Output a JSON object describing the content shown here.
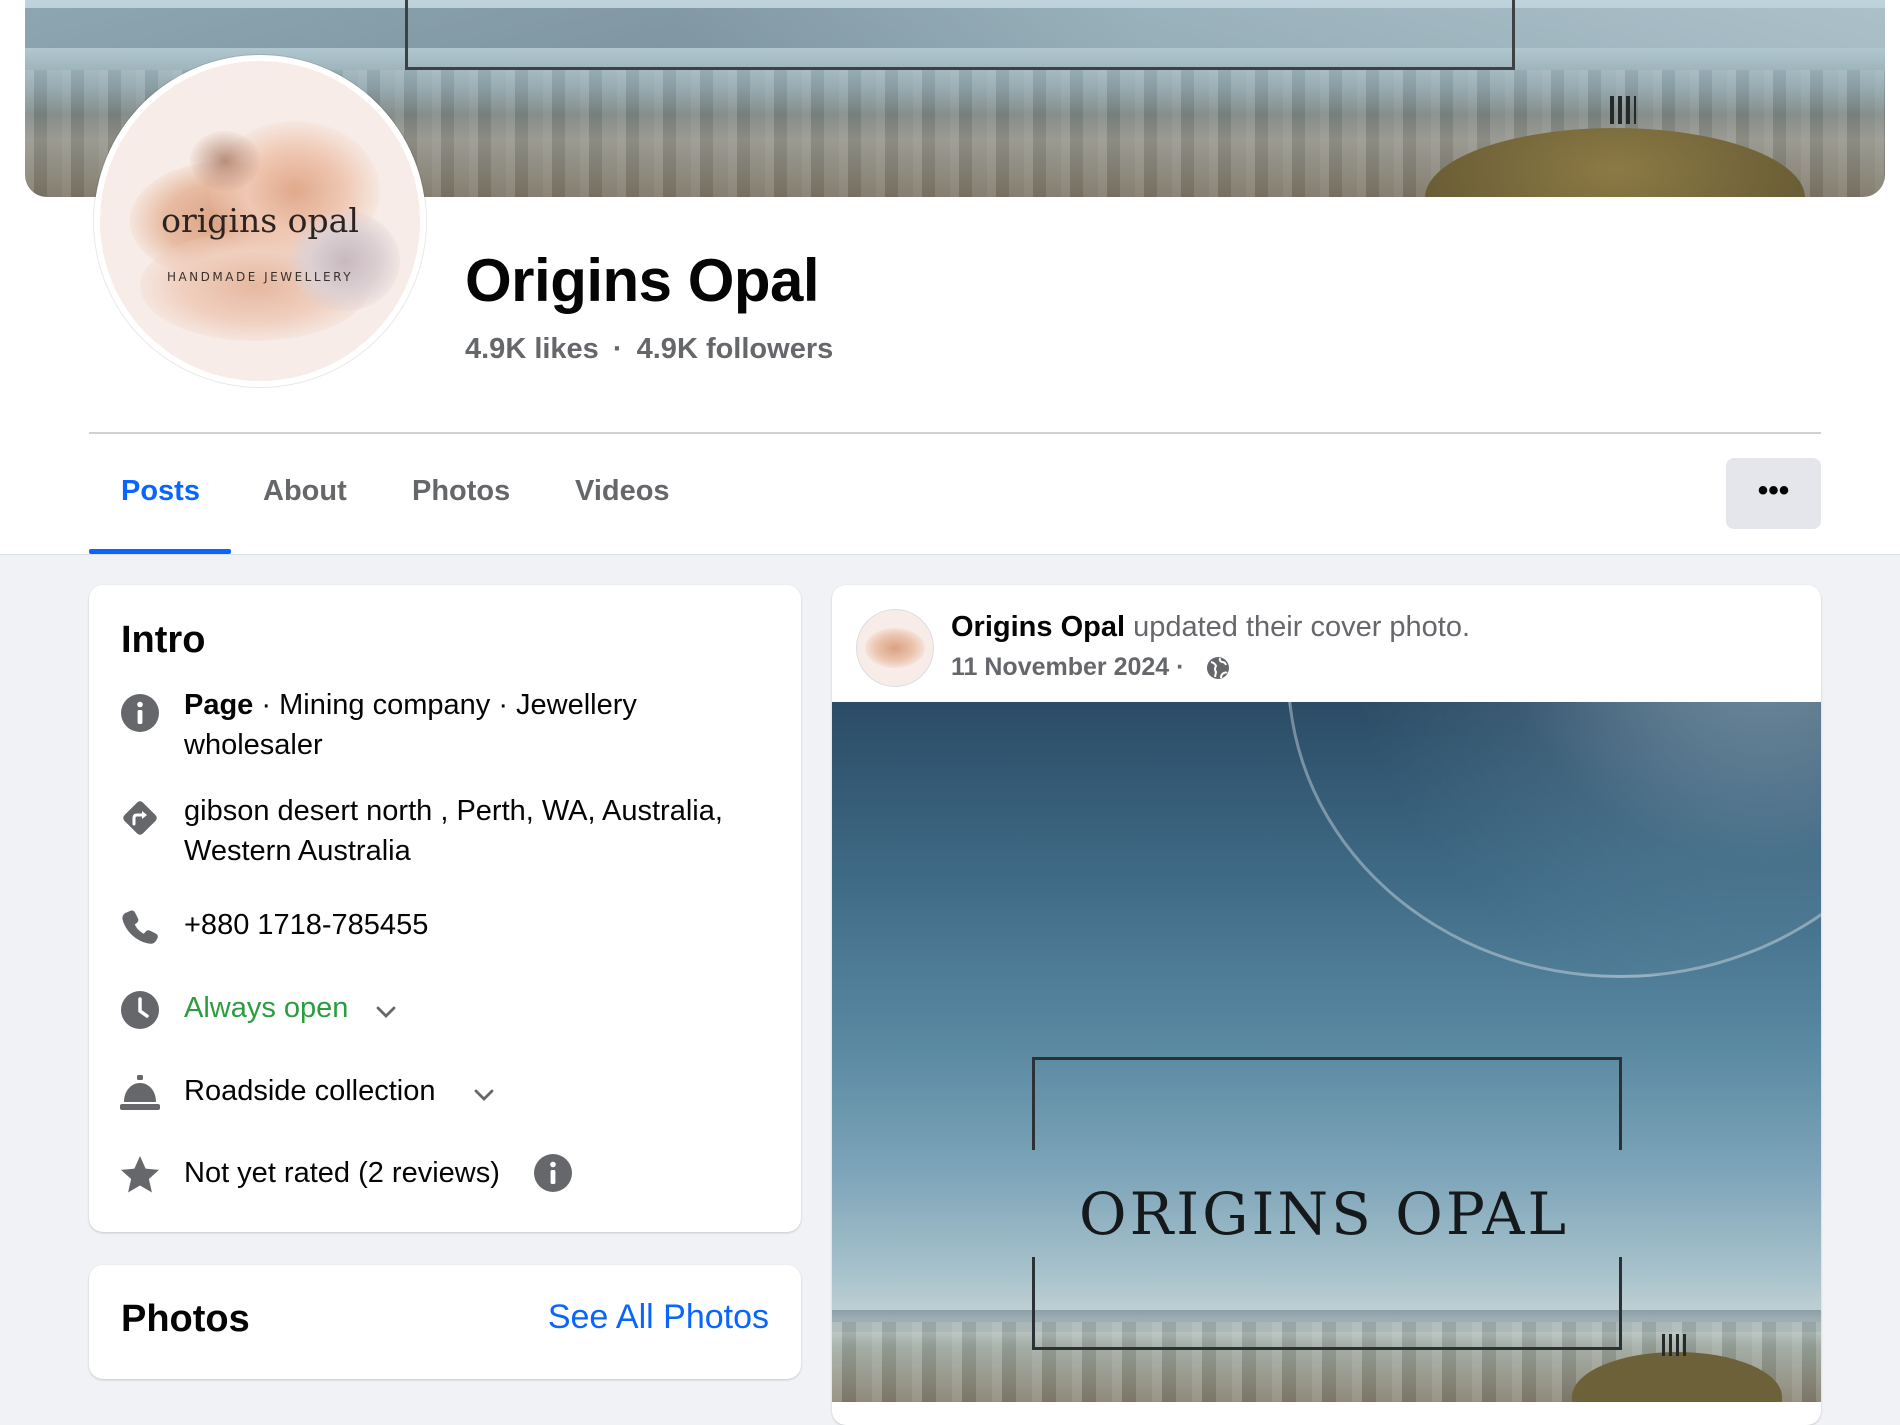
{
  "page": {
    "name": "Origins Opal",
    "likes": "4.9K likes",
    "separator": "·",
    "followers": "4.9K followers"
  },
  "avatar": {
    "brand": "origins opal",
    "tagline": "HANDMADE JEWELLERY"
  },
  "tabs": [
    {
      "label": "Posts",
      "active": true
    },
    {
      "label": "About",
      "active": false
    },
    {
      "label": "Photos",
      "active": false
    },
    {
      "label": "Videos",
      "active": false
    }
  ],
  "more_button": {
    "label": "•••"
  },
  "intro": {
    "title": "Intro",
    "category": {
      "bold": "Page",
      "rest": " · Mining company · Jewellery",
      "line2": "wholesaler",
      "icon": "info-icon"
    },
    "address": {
      "line1": "gibson desert north , Perth, WA, Australia,",
      "line2": "Western Australia",
      "icon": "directions-icon"
    },
    "phone": {
      "text": "+880 1718-785455",
      "icon": "phone-icon"
    },
    "hours": {
      "text": "Always open",
      "icon": "clock-icon",
      "color": "#2a9d3e"
    },
    "service": {
      "text": "Roadside collection",
      "icon": "service-bell-icon"
    },
    "rating": {
      "text": "Not yet rated (2 reviews)",
      "icon": "star-icon"
    }
  },
  "photos_section": {
    "title": "Photos",
    "link": "See All Photos"
  },
  "post": {
    "author": "Origins Opal",
    "action": " updated their cover photo.",
    "date": "11 November 2024",
    "date_separator": " ·",
    "audience_icon": "globe-icon",
    "image_text": "ORIGINS OPAL"
  },
  "colors": {
    "accent": "#0866ff",
    "open_green": "#2a9d3e",
    "secondary_text": "#65676b",
    "background": "#f0f2f5"
  }
}
